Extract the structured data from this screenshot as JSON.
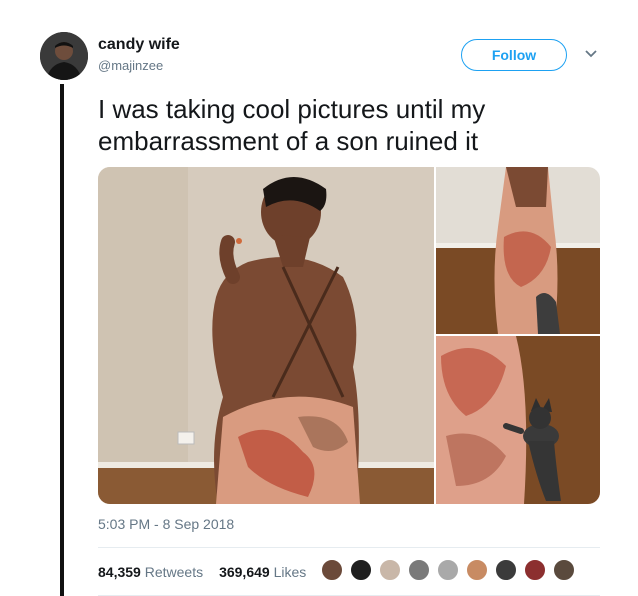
{
  "user": {
    "name": "candy wife",
    "handle": "@majinzee"
  },
  "actions": {
    "follow_label": "Follow"
  },
  "tweet": {
    "text": "I was taking cool pictures until my embarrassment of a son ruined it",
    "timestamp": "5:03 PM - 8 Sep 2018"
  },
  "stats": {
    "retweets_count": "84,359",
    "retweets_label": "Retweets",
    "likes_count": "369,649",
    "likes_label": "Likes"
  },
  "likers": [
    {
      "color": "#6b4a3a"
    },
    {
      "color": "#1f1f1f"
    },
    {
      "color": "#c9b7a8"
    },
    {
      "color": "#7a7a7a"
    },
    {
      "color": "#a9a9a9"
    },
    {
      "color": "#c88b63"
    },
    {
      "color": "#3b3b3b"
    },
    {
      "color": "#8c2f2f"
    },
    {
      "color": "#5a4a3d"
    }
  ],
  "colors": {
    "accent": "#1da1f2",
    "secondary_text": "#657786",
    "primary_text": "#14171a"
  }
}
